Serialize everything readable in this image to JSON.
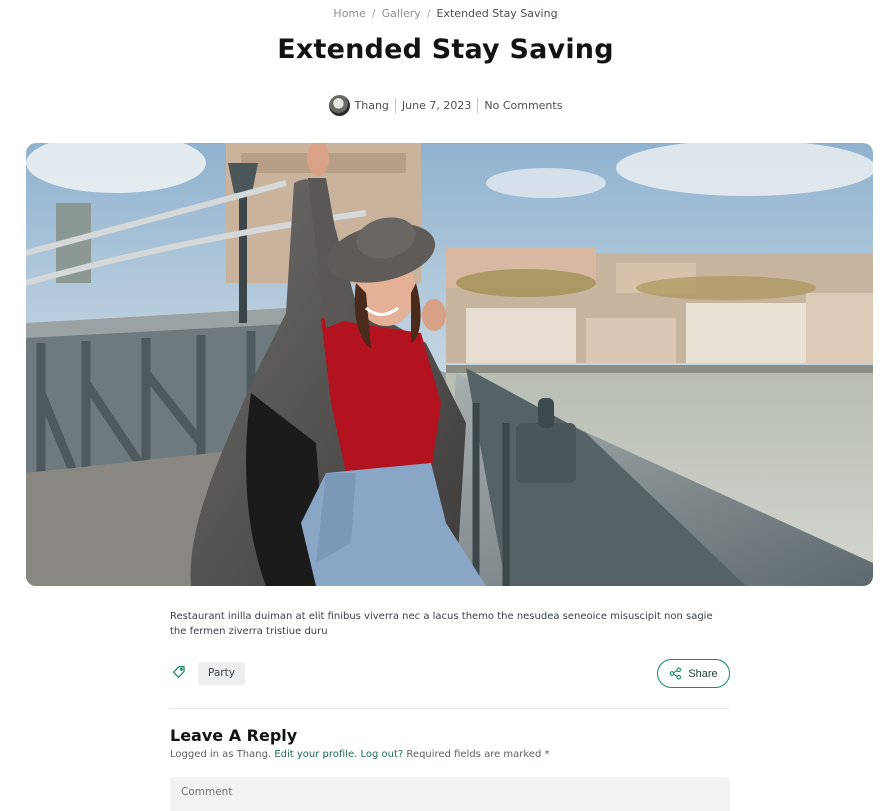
{
  "breadcrumb": {
    "home": "Home",
    "gallery": "Gallery",
    "current": "Extended Stay Saving",
    "separator": "/"
  },
  "post": {
    "title": "Extended Stay Saving",
    "author": "Thang",
    "date": "June 7, 2023",
    "comments": "No Comments",
    "excerpt": "Restaurant inilla duiman at elit finibus viverra nec a lacus themo the nesudea seneoice misuscipit non sagie the fermen ziverra tristiue duru"
  },
  "tags": {
    "icon": "tag-icon",
    "items": [
      "Party"
    ]
  },
  "share": {
    "label": "Share",
    "icon": "share-icon"
  },
  "reply": {
    "title": "Leave A Reply",
    "logged_prefix": "Logged in as Thang.",
    "edit_profile": "Edit your profile.",
    "logout": "Log out?",
    "required_note": "Required fields are marked *",
    "comment_placeholder": "Comment"
  },
  "colors": {
    "accent": "#1f8a64",
    "link": "#1f6b53",
    "tag_bg": "#eceff1"
  }
}
